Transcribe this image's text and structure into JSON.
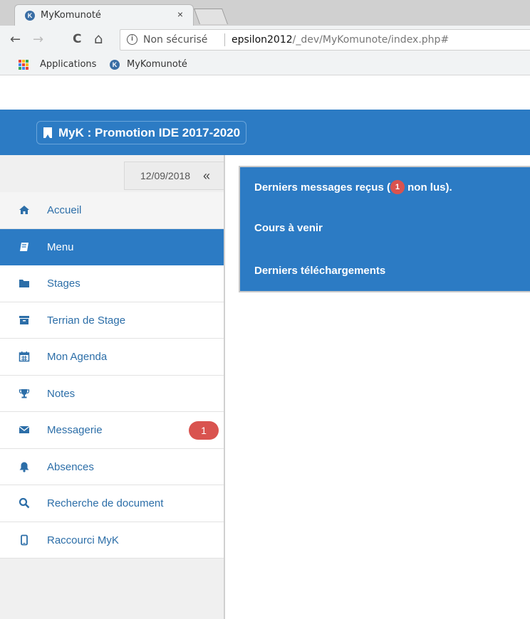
{
  "browser": {
    "tab_title": "MyKomunoté",
    "tab_close": "×",
    "favicon_letter": "K",
    "security_label": "Non sécurisé",
    "url_host": "epsilon2012",
    "url_path": "/_dev/MyKomunote/index.php#",
    "bookmarks": [
      {
        "label": "Applications",
        "icon": "apps-grid-icon"
      },
      {
        "label": "MyKomunoté",
        "icon": "mykomunote-favicon"
      }
    ],
    "nav": {
      "back": "←",
      "forward": "→",
      "reload": "C",
      "home": "⌂"
    }
  },
  "header": {
    "brand": "MyK : Promotion IDE 2017-2020",
    "color": "#2c7bc4"
  },
  "sidebar": {
    "date": "12/09/2018",
    "collapse_glyph": "«",
    "items": [
      {
        "label": "Accueil",
        "icon": "home-icon"
      },
      {
        "label": "Menu",
        "icon": "book-icon",
        "active": true
      },
      {
        "label": "Stages",
        "icon": "folder-icon"
      },
      {
        "label": "Terrian de Stage",
        "icon": "archive-icon"
      },
      {
        "label": "Mon Agenda",
        "icon": "calendar-icon"
      },
      {
        "label": "Notes",
        "icon": "trophy-icon"
      },
      {
        "label": "Messagerie",
        "icon": "envelope-icon",
        "badge": "1"
      },
      {
        "label": "Absences",
        "icon": "bell-icon"
      },
      {
        "label": "Recherche de document",
        "icon": "search-icon"
      },
      {
        "label": "Raccourci MyK",
        "icon": "mobile-icon"
      }
    ]
  },
  "main": {
    "messages_prefix": "Derniers messages reçus (",
    "messages_badge": "1",
    "messages_suffix": " non lus).",
    "courses": "Cours à venir",
    "downloads": "Derniers téléchargements"
  },
  "colors": {
    "accent": "#2c7bc4",
    "badge": "#d9534f"
  }
}
